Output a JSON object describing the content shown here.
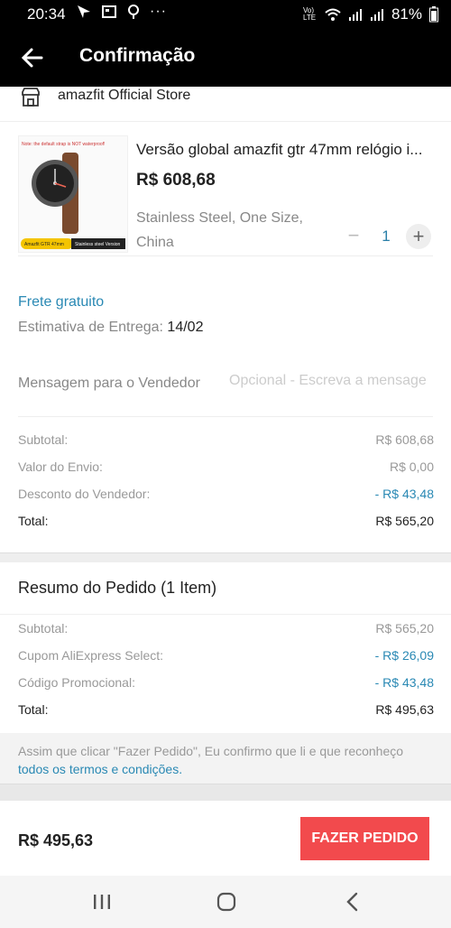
{
  "status_bar": {
    "time": "20:34",
    "battery": "81%",
    "network_label": "Vo) LTE",
    "icons": [
      "navigation-icon",
      "news-icon",
      "location-icon",
      "more-dots-icon",
      "wifi-icon",
      "signal-icon",
      "signal-icon",
      "battery-icon"
    ]
  },
  "header": {
    "title": "Confirmação",
    "back_icon": "arrow-left-icon"
  },
  "store": {
    "name": "amazfit Official Store",
    "icon": "store-icon"
  },
  "product": {
    "name": "Versão global amazfit gtr 47mm relógio i...",
    "price": "R$ 608,68",
    "variant_line1": "Stainless Steel, One Size,",
    "variant_line2": "China",
    "quantity": "1",
    "minus": "−",
    "plus": "+",
    "thumb_text_top": "Note: the default strap is NOT waterproof!",
    "thumb_text_bottom_left": "Amazfit GTR 47mm",
    "thumb_text_bottom_right": "Stainless steel Version"
  },
  "shipping": {
    "free_label": "Frete gratuito",
    "eta_label": "Estimativa de Entrega:",
    "eta_value": "14/02"
  },
  "message": {
    "label": "Mensagem para o Vendedor",
    "placeholder": "Opcional - Escreva a mensage"
  },
  "store_summary": [
    {
      "label": "Subtotal:",
      "value": "R$ 608,68",
      "type": "normal"
    },
    {
      "label": "Valor do Envio:",
      "value": "R$ 0,00",
      "type": "normal"
    },
    {
      "label": "Desconto do Vendedor:",
      "value": "- R$ 43,48",
      "type": "disc"
    },
    {
      "label": "Total:",
      "value": "R$ 565,20",
      "type": "total"
    }
  ],
  "order_summary": {
    "title": "Resumo do Pedido (1 Item)",
    "rows": [
      {
        "label": "Subtotal:",
        "value": "R$ 565,20",
        "type": "normal"
      },
      {
        "label": "Cupom AliExpress Select:",
        "value": "- R$ 26,09",
        "type": "disc"
      },
      {
        "label": "Código Promocional:",
        "value": "- R$ 43,48",
        "type": "disc"
      },
      {
        "label": "Total:",
        "value": "R$ 495,63",
        "type": "total"
      }
    ]
  },
  "terms": {
    "line1": "Assim que clicar \"Fazer Pedido\", Eu confirmo que li e que reconheço",
    "link": "todos os termos e condições."
  },
  "footer": {
    "total": "R$ 495,63",
    "order_button": "FAZER PEDIDO"
  },
  "nav_bar": {
    "icons": [
      "recents-icon",
      "home-icon",
      "back-icon"
    ]
  },
  "colors": {
    "accent_blue": "#2a89b4",
    "button_red": "#f24a4d"
  }
}
